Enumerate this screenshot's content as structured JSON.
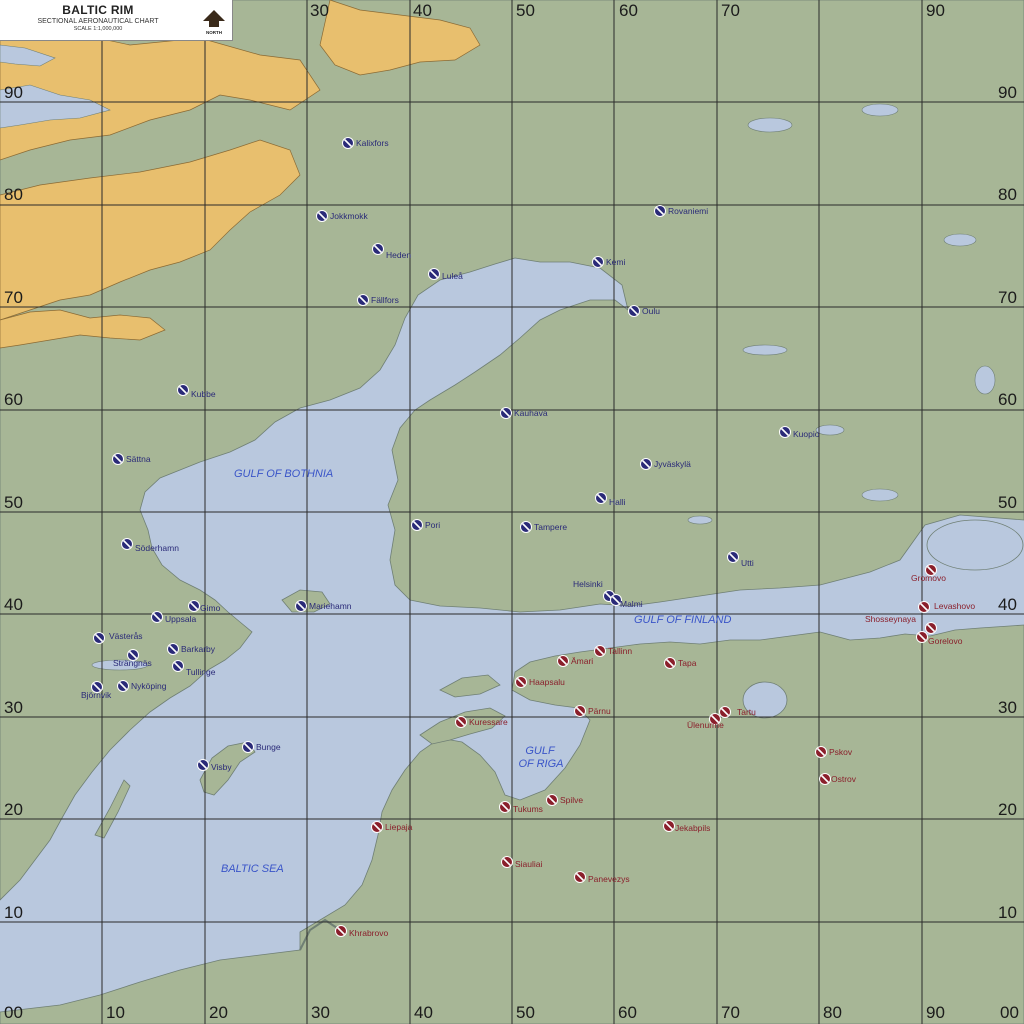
{
  "chart_header": {
    "title": "BALTIC RIM",
    "subtitle": "SECTIONAL AERONAUTICAL CHART",
    "scale": "SCALE 1:1,000,000",
    "north_label": "NORTH"
  },
  "grid": {
    "top_labels": [
      "30",
      "40",
      "50",
      "60",
      "70",
      "90"
    ],
    "bottom_labels": [
      "00",
      "10",
      "20",
      "30",
      "40",
      "50",
      "60",
      "70",
      "80",
      "90",
      "00"
    ],
    "left_labels": [
      "90",
      "80",
      "70",
      "60",
      "50",
      "40",
      "30",
      "20",
      "10"
    ],
    "right_labels": [
      "90",
      "80",
      "70",
      "60",
      "50",
      "40",
      "30",
      "20",
      "10"
    ]
  },
  "water_labels": {
    "gulf_of_bothnia": "GULF OF BOTHNIA",
    "gulf_of_finland": "GULF OF FINLAND",
    "gulf_of_riga_line1": "GULF",
    "gulf_of_riga_line2": "OF RIGA",
    "baltic_sea": "BALTIC SEA"
  },
  "colors": {
    "sea": "#b9c8de",
    "land": "#a7b696",
    "highland": "#e8bf6e",
    "grid": "#2a2a2a",
    "blue_airfield": "#2a2a78",
    "red_airfield": "#8a1f2b"
  },
  "airfields": [
    {
      "name": "Kalixfors",
      "side": "blue"
    },
    {
      "name": "Jokkmokk",
      "side": "blue"
    },
    {
      "name": "Heden",
      "side": "blue"
    },
    {
      "name": "Luleå",
      "side": "blue"
    },
    {
      "name": "Fällfors",
      "side": "blue"
    },
    {
      "name": "Rovaniemi",
      "side": "blue"
    },
    {
      "name": "Kemi",
      "side": "blue"
    },
    {
      "name": "Oulu",
      "side": "blue"
    },
    {
      "name": "Kubbe",
      "side": "blue"
    },
    {
      "name": "Kauhava",
      "side": "blue"
    },
    {
      "name": "Kuopio",
      "side": "blue"
    },
    {
      "name": "Sättna",
      "side": "blue"
    },
    {
      "name": "Jyväskylä",
      "side": "blue"
    },
    {
      "name": "Halli",
      "side": "blue"
    },
    {
      "name": "Pori",
      "side": "blue"
    },
    {
      "name": "Tampere",
      "side": "blue"
    },
    {
      "name": "Söderhamn",
      "side": "blue"
    },
    {
      "name": "Utti",
      "side": "blue"
    },
    {
      "name": "Helsinki",
      "side": "blue"
    },
    {
      "name": "Malmi",
      "side": "blue"
    },
    {
      "name": "Gimo",
      "side": "blue"
    },
    {
      "name": "Uppsala",
      "side": "blue"
    },
    {
      "name": "Mariehamn",
      "side": "blue"
    },
    {
      "name": "Västerås",
      "side": "blue"
    },
    {
      "name": "Barkarby",
      "side": "blue"
    },
    {
      "name": "Strängnäs",
      "side": "blue"
    },
    {
      "name": "Tullinge",
      "side": "blue"
    },
    {
      "name": "Nyköping",
      "side": "blue"
    },
    {
      "name": "Björnvik",
      "side": "blue"
    },
    {
      "name": "Bunge",
      "side": "blue"
    },
    {
      "name": "Visby",
      "side": "blue"
    },
    {
      "name": "Gromovo",
      "side": "red"
    },
    {
      "name": "Levashovo",
      "side": "red"
    },
    {
      "name": "Shosseynaya",
      "side": "red"
    },
    {
      "name": "Gorelovo",
      "side": "red"
    },
    {
      "name": "Tallinn",
      "side": "red"
    },
    {
      "name": "Ämari",
      "side": "red"
    },
    {
      "name": "Tapa",
      "side": "red"
    },
    {
      "name": "Haapsalu",
      "side": "red"
    },
    {
      "name": "Pärnu",
      "side": "red"
    },
    {
      "name": "Tartu",
      "side": "red"
    },
    {
      "name": "Ülenurme",
      "side": "red"
    },
    {
      "name": "Kuressare",
      "side": "red"
    },
    {
      "name": "Pskov",
      "side": "red"
    },
    {
      "name": "Ostrov",
      "side": "red"
    },
    {
      "name": "Tukums",
      "side": "red"
    },
    {
      "name": "Spilve",
      "side": "red"
    },
    {
      "name": "Liepaja",
      "side": "red"
    },
    {
      "name": "Jekabpils",
      "side": "red"
    },
    {
      "name": "Siauliai",
      "side": "red"
    },
    {
      "name": "Panevezys",
      "side": "red"
    },
    {
      "name": "Khrabrovo",
      "side": "red"
    }
  ]
}
